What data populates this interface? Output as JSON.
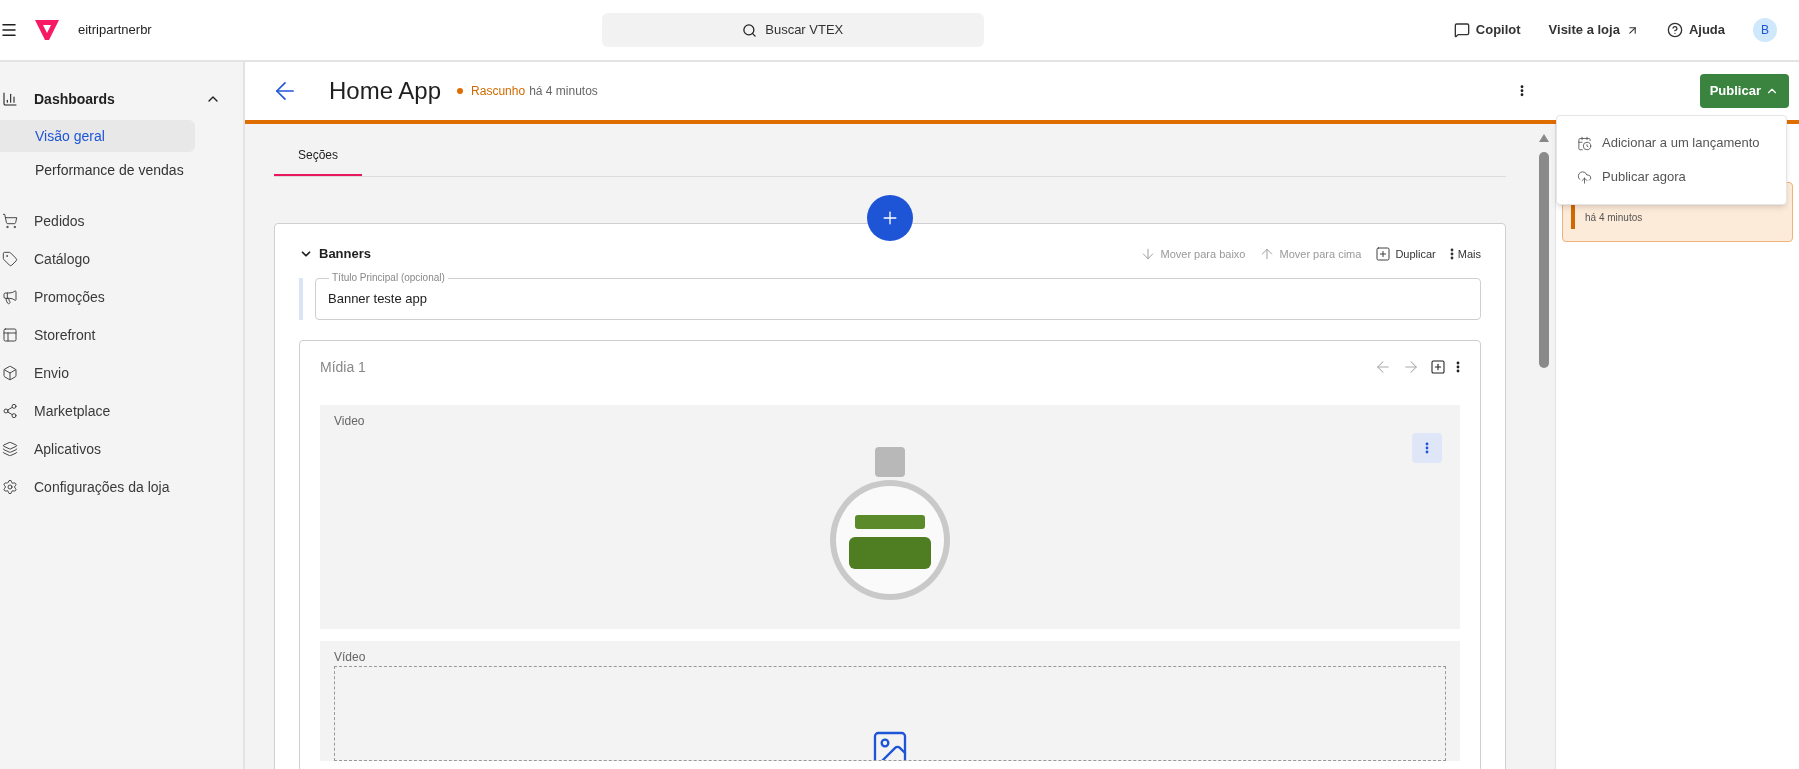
{
  "topbar": {
    "account": "eitripartnerbr",
    "search": {
      "placeholder": "Buscar VTEX"
    },
    "links": [
      "Copilot",
      "Visite a loja",
      "Ajuda"
    ],
    "avatar": "B"
  },
  "sidebar": {
    "items": [
      {
        "label": "Dashboards",
        "kind": "group",
        "expanded": true,
        "children": [
          {
            "label": "Visão geral",
            "selected": true
          },
          {
            "label": "Performance de vendas",
            "selected": false
          }
        ]
      },
      {
        "label": "Pedidos",
        "kind": "item"
      },
      {
        "label": "Catálogo",
        "kind": "item"
      },
      {
        "label": "Promoções",
        "kind": "item"
      },
      {
        "label": "Storefront",
        "kind": "item"
      },
      {
        "label": "Envio",
        "kind": "item"
      },
      {
        "label": "Marketplace",
        "kind": "item"
      },
      {
        "label": "Aplicativos",
        "kind": "item"
      },
      {
        "label": "Configurações da loja",
        "kind": "item"
      }
    ]
  },
  "page_header": {
    "title": "Home App",
    "status": "Rascunho",
    "updated": "há 4 minutos",
    "publish_button": "Publicar",
    "menu_open": true
  },
  "publish_menu": [
    "Adicionar a um lançamento",
    "Publicar agora"
  ],
  "side_card": {
    "time": "há 4 minutos"
  },
  "tabs": [
    {
      "label": "Seções",
      "selected": true
    }
  ],
  "section": {
    "title": "Banners",
    "expanded": true,
    "actions": [
      {
        "label": "Mover para baixo",
        "disabled": true
      },
      {
        "label": "Mover para cima",
        "disabled": true
      },
      {
        "label": "Duplicar",
        "disabled": false
      },
      {
        "label": "Mais",
        "disabled": false
      }
    ],
    "title_field": {
      "label": "Título Principal (opcional)",
      "value": "Banner teste app"
    },
    "media": {
      "title": "Mídia 1",
      "items": [
        {
          "label": "Video",
          "kind": "image"
        },
        {
          "label": "Vídeo",
          "kind": "empty"
        }
      ]
    }
  }
}
